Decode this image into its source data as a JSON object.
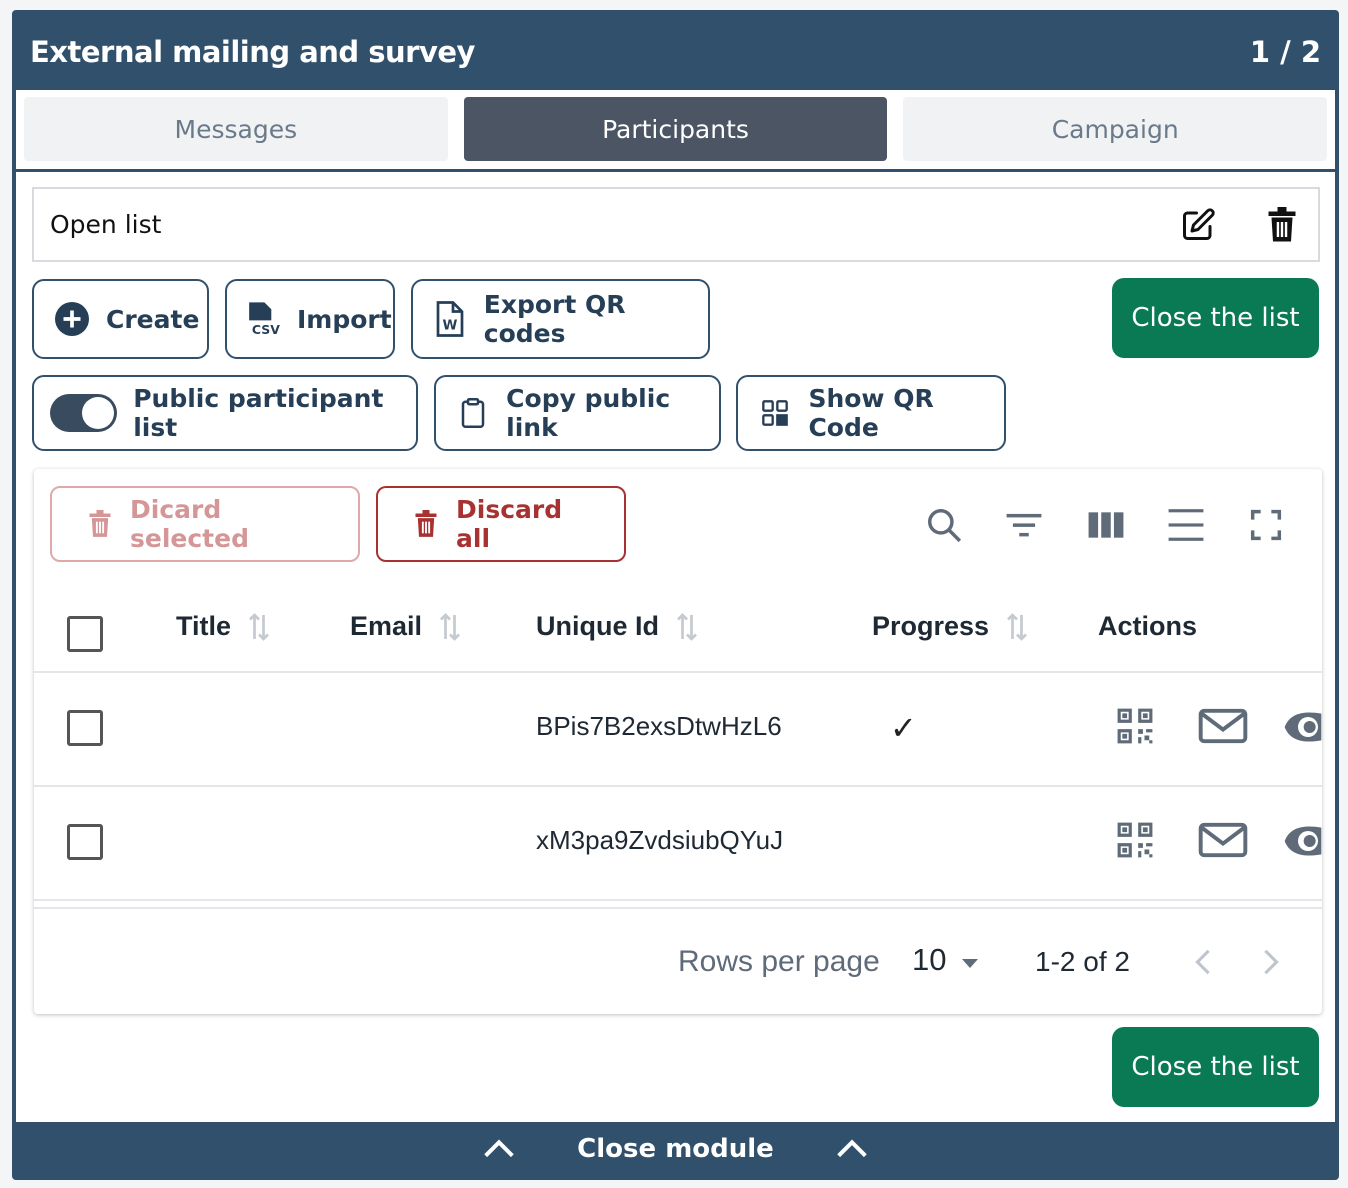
{
  "header": {
    "title": "External mailing and survey",
    "pager": "1 / 2"
  },
  "tabs": [
    {
      "label": "Messages",
      "active": false
    },
    {
      "label": "Participants",
      "active": true
    },
    {
      "label": "Campaign",
      "active": false
    }
  ],
  "open_list": {
    "label": "Open list",
    "edit_icon": "edit-icon",
    "delete_icon": "trash-icon"
  },
  "actions": {
    "create_label": "Create",
    "import_label": "Import",
    "export_qr_label": "Export QR codes",
    "close_list_label": "Close the list",
    "public_list_label": "Public participant list",
    "public_list_enabled": true,
    "copy_link_label": "Copy public link",
    "show_qr_label": "Show QR Code"
  },
  "table": {
    "discard_selected_label": "Dicard selected",
    "discard_all_label": "Discard all",
    "columns": [
      "Title",
      "Email",
      "Unique Id",
      "Progress",
      "Actions"
    ],
    "rows": [
      {
        "title": "",
        "email": "",
        "unique_id": "BPis7B2exsDtwHzL6",
        "progress": "✓"
      },
      {
        "title": "",
        "email": "",
        "unique_id": "xM3pa9ZvdsiubQYuJ",
        "progress": ""
      }
    ],
    "footer": {
      "rows_per_page_label": "Rows per page",
      "rows_per_page_value": "10",
      "range": "1-2 of 2"
    }
  },
  "bottom_close_list_label": "Close the list",
  "close_module_label": "Close module",
  "colors": {
    "primary": "#31506c",
    "green": "#0a7a55",
    "danger": "#a83232"
  }
}
